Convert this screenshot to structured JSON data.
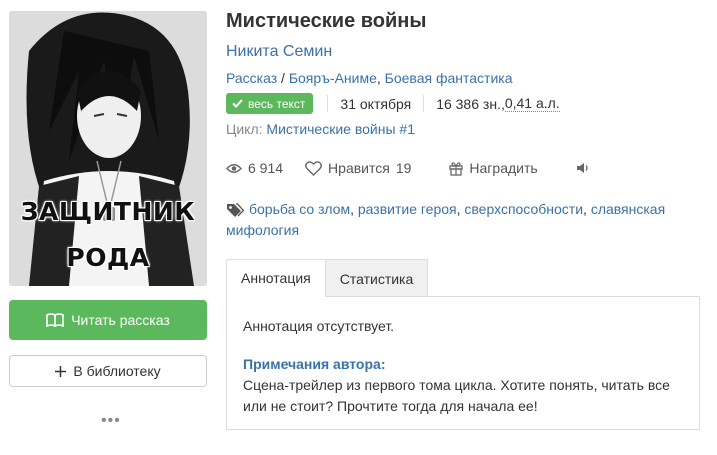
{
  "cover": {
    "text_line1": "ЗАЩИТНИК",
    "text_line2": "РОДА"
  },
  "actions": {
    "read_label": "Читать рассказ",
    "read_icon": "open-book-icon",
    "library_label": "В библиотеку",
    "library_icon": "plus-icon",
    "more_label": "•••"
  },
  "book": {
    "title": "Мистические войны",
    "author": "Никита Семин",
    "form": "Рассказ",
    "genre_sep": " / ",
    "genres": [
      "Бояръ-Аниме",
      "Боевая фантастика"
    ],
    "genre_comma": ", ",
    "status_badge": "весь текст",
    "date": "31 октября",
    "size": "16 386 зн.",
    "size_comma": ", ",
    "size_al": "0,41 а.л.",
    "cycle_label": "Цикл: ",
    "cycle_name": "Мистические войны #1"
  },
  "stats": {
    "views": "6 914",
    "likes_label": "Нравится",
    "likes": "19",
    "reward_label": "Наградить"
  },
  "tags": {
    "items": [
      "борьба со злом",
      "развитие героя",
      "сверхспособности",
      "славянская мифология"
    ],
    "sep": ", "
  },
  "tabs": {
    "annotation": "Аннотация",
    "statistics": "Статистика"
  },
  "content": {
    "annotation_text": "Аннотация отсутствует.",
    "notes_heading": "Примечания автора:",
    "notes_text": "Сцена-трейлер из первого тома цикла. Хотите понять, читать все или не стоит? Прочтите тогда для начала ее!"
  },
  "colors": {
    "link": "#3a72a8",
    "green": "#5cb85c"
  }
}
